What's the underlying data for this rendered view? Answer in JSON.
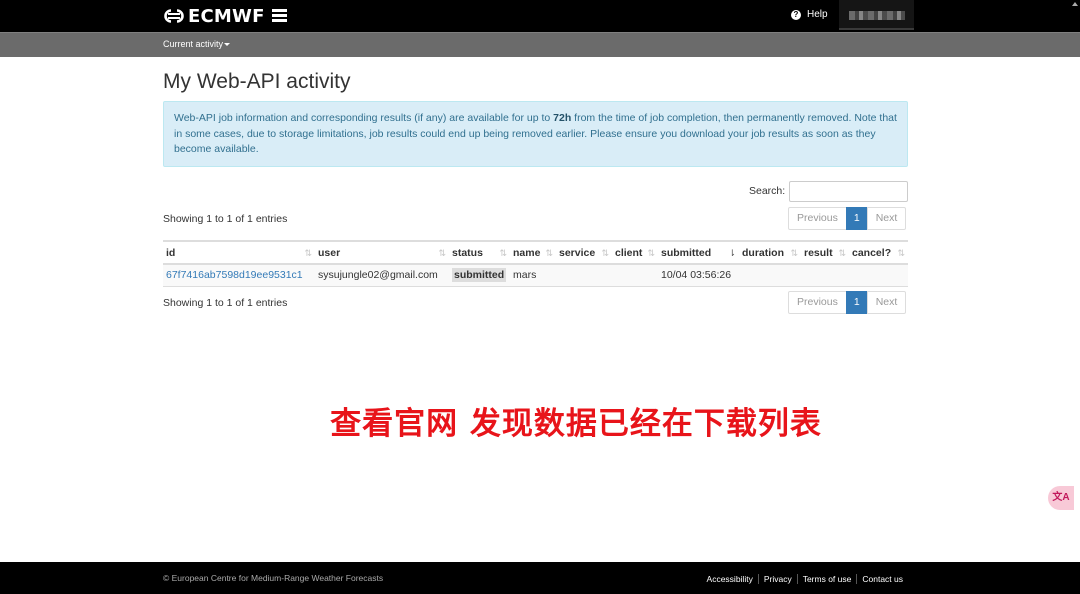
{
  "header": {
    "logo_text": "ECMWF",
    "help_label": "Help",
    "menu_icon": "hamburger-icon"
  },
  "subnav": {
    "current_activity_label": "Current activity"
  },
  "main": {
    "title": "My Web-API activity",
    "alert": {
      "part1": "Web-API job information and corresponding results (if any) are available for up to ",
      "bold": "72h",
      "part2": " from the time of job completion, then permanently removed. Note that in some cases, due to storage limitations, job results could end up being removed earlier. Please ensure you download your job results as soon as they become available."
    },
    "search_label": "Search:",
    "search_value": "",
    "info_top": "Showing 1 to 1 of 1 entries",
    "info_bottom": "Showing 1 to 1 of 1 entries",
    "pager": {
      "previous": "Previous",
      "current": "1",
      "next": "Next"
    },
    "columns": [
      "id",
      "user",
      "status",
      "name",
      "service",
      "client",
      "submitted",
      "duration",
      "result",
      "cancel?"
    ],
    "rows": [
      {
        "id": "67f7416ab7598d19ee9531c1",
        "user": "sysujungle02@gmail.com",
        "status": "submitted",
        "name": "mars",
        "service": "",
        "client": "",
        "submitted": "10/04 03:56:26",
        "duration": "",
        "result": "",
        "cancel": ""
      }
    ]
  },
  "overlay_caption": "查看官网 发现数据已经在下载列表",
  "float_widget_label": "文A",
  "footer": {
    "copyright": "© European Centre for Medium-Range Weather Forecasts",
    "links": [
      "Accessibility",
      "Privacy",
      "Terms of use",
      "Contact us"
    ]
  },
  "colors": {
    "link": "#337ab7",
    "alert_bg": "#d9edf7",
    "alert_text": "#31708f",
    "caption": "#e8141a",
    "header_bg": "#000000",
    "subbar_bg": "#6b6b6b"
  }
}
